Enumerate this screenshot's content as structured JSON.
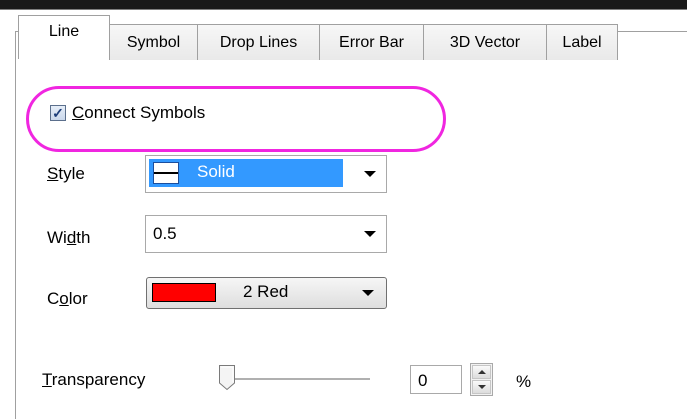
{
  "tabs": [
    {
      "label": "Line",
      "active": true
    },
    {
      "label": "Symbol",
      "active": false
    },
    {
      "label": "Drop Lines",
      "active": false
    },
    {
      "label": "Error Bar",
      "active": false
    },
    {
      "label": "3D Vector",
      "active": false
    },
    {
      "label": "Label",
      "active": false
    }
  ],
  "connect_symbols": {
    "label_prefix": "C",
    "label_rest": "onnect Symbols",
    "checked": true
  },
  "style": {
    "label_prefix": "S",
    "label_rest": "tyle",
    "value": "Solid"
  },
  "width": {
    "label_pre": "Wi",
    "label_mnemonic": "d",
    "label_post": "th",
    "value": "0.5"
  },
  "color": {
    "label_pre": "C",
    "label_mnemonic": "o",
    "label_post": "lor",
    "value": "2 Red",
    "swatch": "#ff0000"
  },
  "transparency": {
    "label_prefix": "T",
    "label_rest": "ransparency",
    "value": "0",
    "unit": "%",
    "slider_level": 0
  },
  "colors": {
    "highlight": "#f026e0",
    "selection": "#3399ff"
  }
}
